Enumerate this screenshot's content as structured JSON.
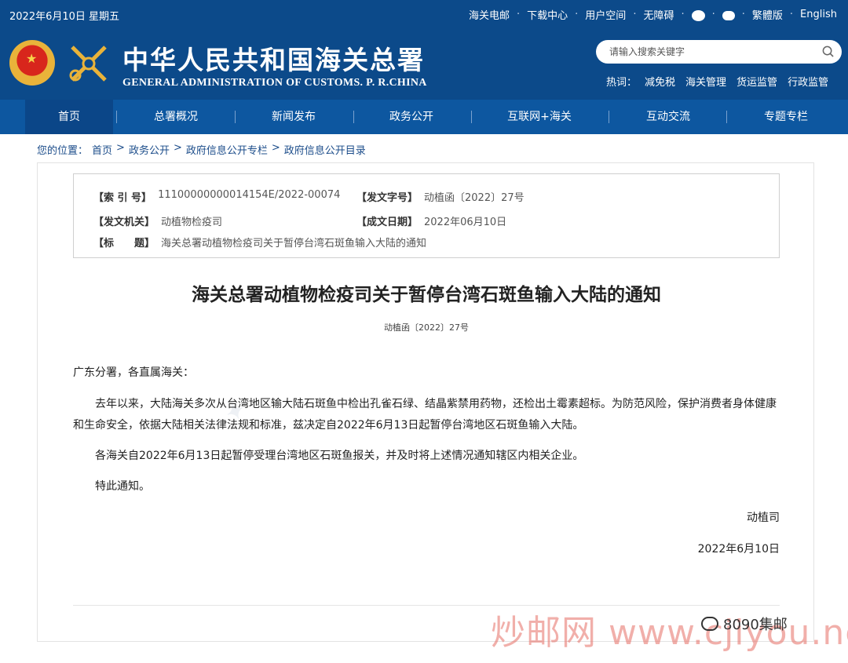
{
  "header": {
    "date": "2022年6月10日 星期五",
    "top_links": [
      "海关电邮",
      "下载中心",
      "用户空间",
      "无障碍",
      "繁體版",
      "English"
    ],
    "site_title_cn": "中华人民共和国海关总署",
    "site_title_en": "GENERAL ADMINISTRATION OF CUSTOMS. P. R.CHINA",
    "search_placeholder": "请输入搜索关键字",
    "hot_label": "热词：",
    "hot_words": [
      "减免税",
      "海关管理",
      "货运监管",
      "行政监管"
    ]
  },
  "nav": {
    "items": [
      "首页",
      "总署概况",
      "新闻发布",
      "政务公开",
      "互联网+海关",
      "互动交流",
      "专题专栏"
    ],
    "active": "首页"
  },
  "breadcrumb": {
    "prefix": "您的位置：",
    "items": [
      "首页",
      "政务公开",
      "政府信息公开专栏",
      "政府信息公开目录"
    ],
    "separator": ">"
  },
  "meta": {
    "index_label": "【索 引 号】",
    "index_value": "11100000000014154E/2022-00074",
    "docno_label": "【发文字号】",
    "docno_value": "动植函〔2022〕27号",
    "org_label": "【发文机关】",
    "org_value": "动植物检疫司",
    "date_label": "【成文日期】",
    "date_value": "2022年06月10日",
    "title_label": "【标　　题】",
    "title_value": "海关总署动植物检疫司关于暂停台湾石斑鱼输入大陆的通知"
  },
  "article": {
    "title": "海关总署动植物检疫司关于暂停台湾石斑鱼输入大陆的通知",
    "doc_number": "动植函〔2022〕27号",
    "salutation": "广东分署，各直属海关：",
    "para1": "去年以来，大陆海关多次从台湾地区输大陆石斑鱼中检出孔雀石绿、结晶紫禁用药物，还检出土霉素超标。为防范风险，保护消费者身体健康和生命安全，依据大陆相关法律法规和标准，兹决定自2022年6月13日起暂停台湾地区石斑鱼输入大陆。",
    "para2": "各海关自2022年6月13日起暂停受理台湾地区石斑鱼报关，并及时将上述情况通知辖区内相关企业。",
    "para3": "特此通知。",
    "signer": "动植司",
    "sign_date": "2022年6月10日"
  },
  "overlay": {
    "watermark": "炒邮网 www.cjiyou.net",
    "wechat_tag": "8090集邮"
  },
  "colors": {
    "header_bg": "#0c4a8a",
    "nav_bg": "#0d57a0",
    "nav_active": "#0b4688",
    "link": "#1b4c8a"
  }
}
